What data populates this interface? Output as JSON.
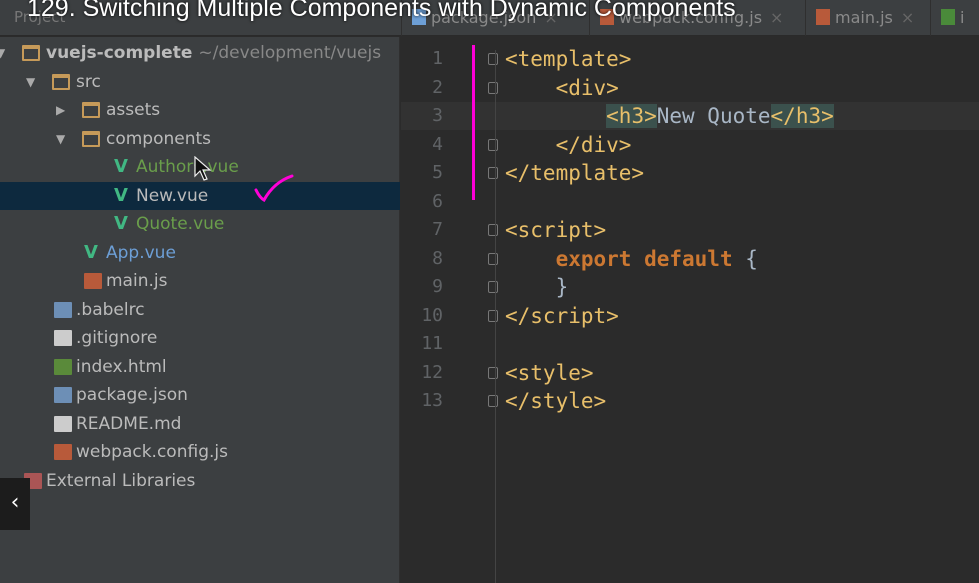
{
  "video_title": "129. Switching Multiple Components with Dynamic Components",
  "tabs": {
    "project": "Project",
    "files": [
      {
        "label": "package.json",
        "icon": "json-file-icon"
      },
      {
        "label": "webpack.config.js",
        "icon": "js-file-icon"
      },
      {
        "label": "main.js",
        "icon": "js-file-icon"
      },
      {
        "label": "i",
        "icon": "html-file-icon"
      }
    ]
  },
  "tree": [
    {
      "label": "vuejs-complete",
      "path": "~/development/vuejs",
      "icon": "folder-icon",
      "expanded": true
    },
    {
      "label": "src",
      "icon": "folder-icon",
      "expanded": true
    },
    {
      "label": "assets",
      "icon": "folder-icon",
      "expanded": false
    },
    {
      "label": "components",
      "icon": "folder-icon",
      "expanded": true
    },
    {
      "label": "Authors.vue",
      "icon": "vue-icon"
    },
    {
      "label": "New.vue",
      "icon": "vue-icon",
      "selected": true
    },
    {
      "label": "Quote.vue",
      "icon": "vue-icon"
    },
    {
      "label": "App.vue",
      "icon": "vue-icon"
    },
    {
      "label": "main.js",
      "icon": "js-file-icon"
    },
    {
      "label": ".babelrc",
      "icon": "json-file-icon"
    },
    {
      "label": ".gitignore",
      "icon": "git-icon"
    },
    {
      "label": "index.html",
      "icon": "html-file-icon"
    },
    {
      "label": "package.json",
      "icon": "json-file-icon"
    },
    {
      "label": "README.md",
      "icon": "md-file-icon"
    },
    {
      "label": "webpack.config.js",
      "icon": "js-file-icon"
    },
    {
      "label": "External Libraries",
      "icon": "library-icon"
    }
  ],
  "code": [
    {
      "n": "1",
      "t": [
        [
          "tag",
          "<template>"
        ]
      ]
    },
    {
      "n": "2",
      "t": [
        [
          "txt",
          "    "
        ],
        [
          "tag",
          "<div>"
        ]
      ]
    },
    {
      "n": "3",
      "t": [
        [
          "txt",
          "        "
        ],
        [
          "tag hl",
          "<h3>"
        ],
        [
          "txt",
          "New Quote"
        ],
        [
          "tag hl",
          "</h3>"
        ]
      ]
    },
    {
      "n": "4",
      "t": [
        [
          "txt",
          "    "
        ],
        [
          "tag",
          "</div>"
        ]
      ]
    },
    {
      "n": "5",
      "t": [
        [
          "tag",
          "</template>"
        ]
      ]
    },
    {
      "n": "6",
      "t": []
    },
    {
      "n": "7",
      "t": [
        [
          "tag",
          "<script>"
        ]
      ]
    },
    {
      "n": "8",
      "t": [
        [
          "txt",
          "    "
        ],
        [
          "kw",
          "export default"
        ],
        [
          "txt",
          " {"
        ]
      ]
    },
    {
      "n": "9",
      "t": [
        [
          "txt",
          "    }"
        ]
      ]
    },
    {
      "n": "10",
      "t": [
        [
          "tag",
          "</script>"
        ]
      ]
    },
    {
      "n": "11",
      "t": []
    },
    {
      "n": "12",
      "t": [
        [
          "tag",
          "<style>"
        ]
      ]
    },
    {
      "n": "13",
      "t": [
        [
          "tag",
          "</style>"
        ]
      ]
    }
  ],
  "back_label": "‹",
  "colors": {
    "annotation": "#ff00d8",
    "selection": "#0d293e",
    "tag": "#e8bf6a",
    "keyword": "#cc7832"
  }
}
